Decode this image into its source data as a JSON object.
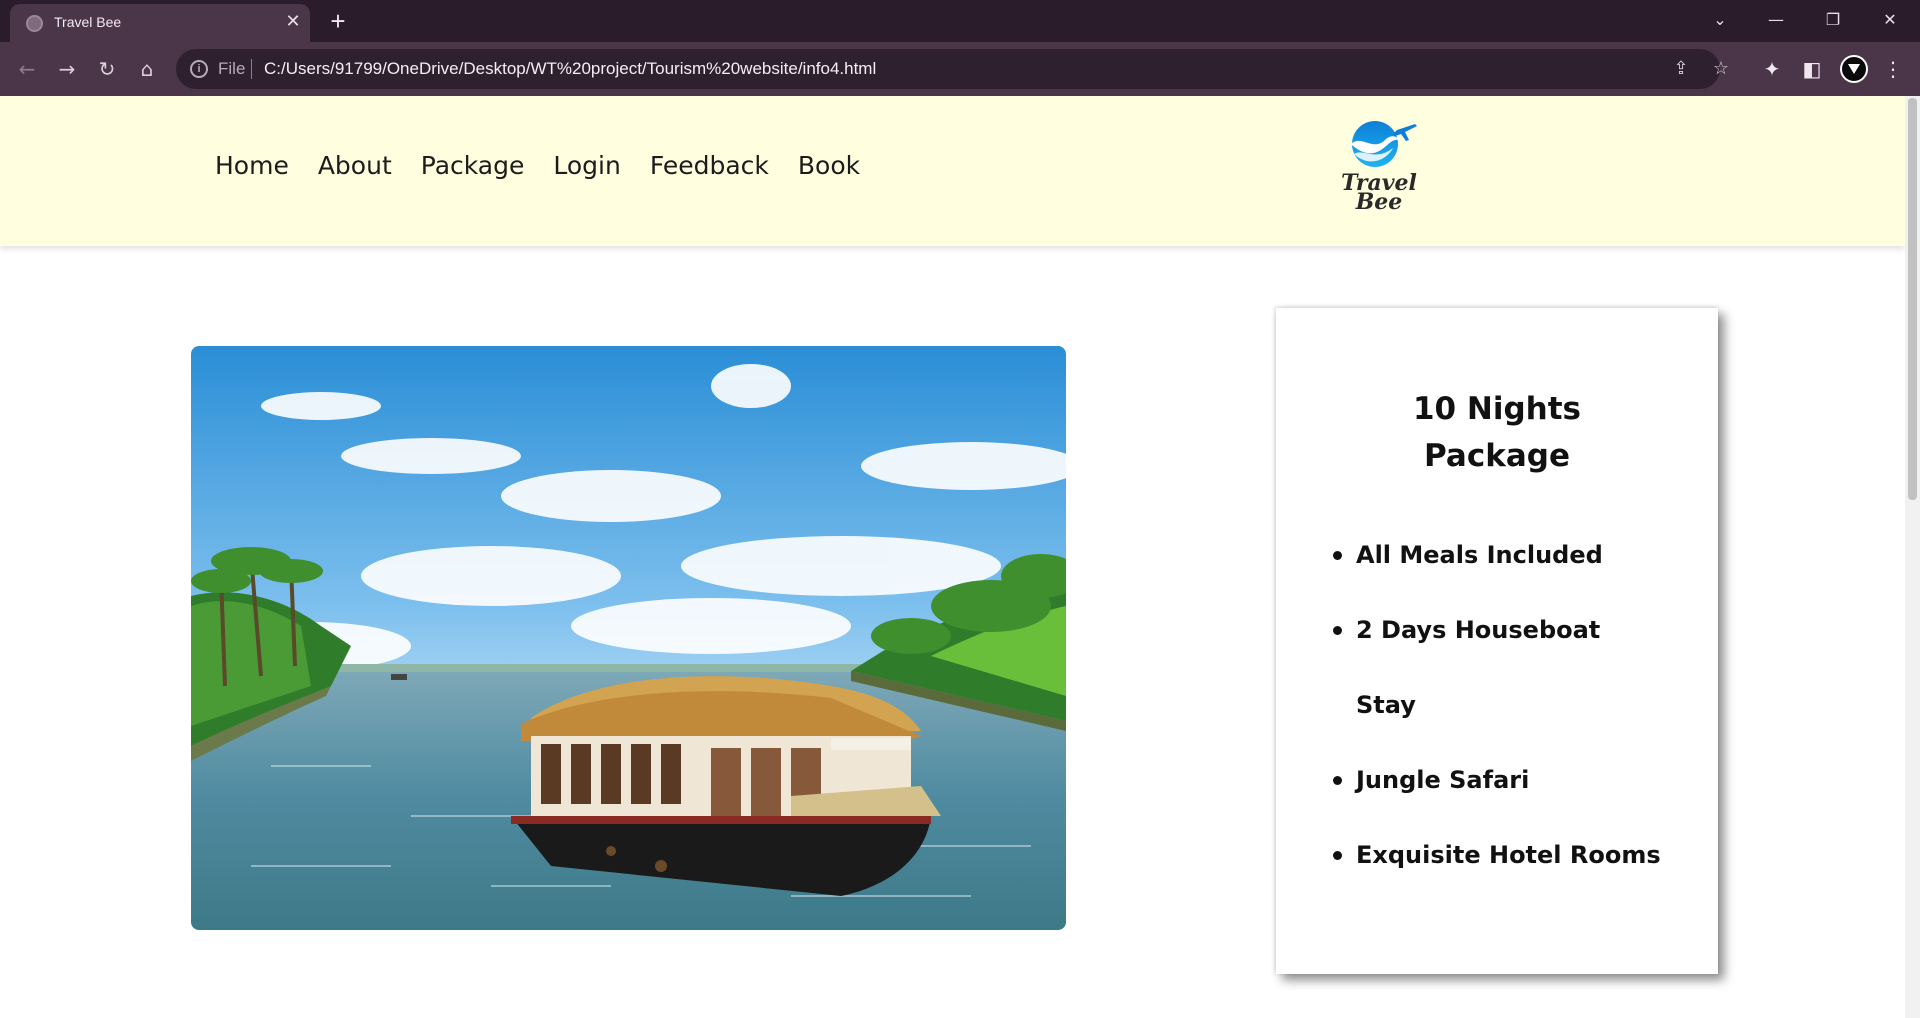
{
  "browser": {
    "tab_title": "Travel Bee",
    "tab_close": "✕",
    "new_tab": "+",
    "window_controls": {
      "tabs_menu": "⌄",
      "minimize": "—",
      "restore": "❐",
      "close": "✕"
    },
    "toolbar": {
      "back": "←",
      "forward": "→",
      "reload": "↻",
      "home": "⌂"
    },
    "omnibox": {
      "info": "i",
      "scheme_label": "File",
      "url": "C:/Users/91799/OneDrive/Desktop/WT%20project/Tourism%20website/info4.html",
      "share": "⇪",
      "bookmark": "☆"
    },
    "extensions": "✦",
    "side_panel": "◧",
    "menu": "⋮"
  },
  "site": {
    "nav": [
      "Home",
      "About",
      "Package",
      "Login",
      "Feedback",
      "Book"
    ],
    "logo": {
      "line1": "Travel",
      "line2": "Bee"
    },
    "package": {
      "title_line1": "10 Nights",
      "title_line2": "Package",
      "features": [
        "All Meals Included",
        "2 Days Houseboat",
        "Stay",
        "Jungle Safari",
        "Exquisite Hotel Rooms"
      ]
    },
    "colors": {
      "header_bg": "#ffffe0",
      "chrome_bg": "#2b1c2b",
      "toolbar_bg": "#4a3549"
    }
  }
}
